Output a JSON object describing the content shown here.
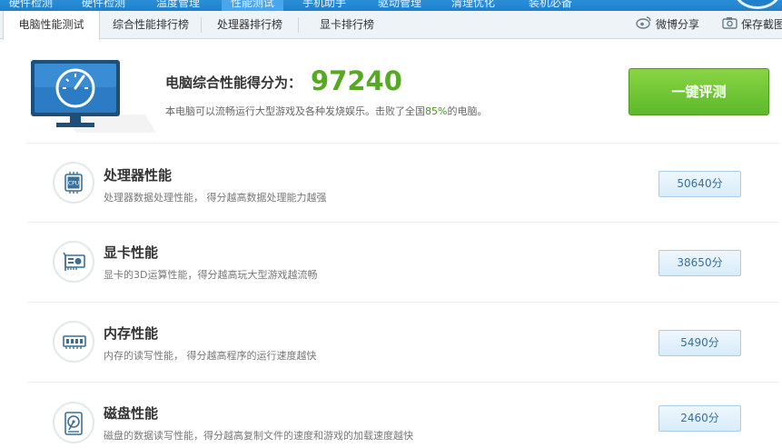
{
  "top_nav": {
    "items": [
      "硬件检测",
      "硬件检测",
      "温度管理",
      "性能测试",
      "手机助手",
      "驱动管理",
      "清理优化",
      "装机必备"
    ]
  },
  "tabs": [
    {
      "label": "电脑性能测试",
      "active": true
    },
    {
      "label": "综合性能排行榜",
      "active": false
    },
    {
      "label": "处理器排行榜",
      "active": false
    },
    {
      "label": "显卡排行榜",
      "active": false
    }
  ],
  "actions": {
    "weibo_share": "微博分享",
    "save_screenshot": "保存截图"
  },
  "summary": {
    "title": "电脑综合性能得分为：",
    "score": "97240",
    "desc_before": "本电脑可以流畅运行大型游戏及各种发烧娱乐。击败了全国",
    "beat_percent": "85%",
    "desc_after": "的电脑。",
    "button": "一键评测"
  },
  "rows": [
    {
      "icon": "cpu-icon",
      "title": "处理器性能",
      "desc": "处理器数据处理性能， 得分越高数据处理能力越强",
      "score": "50640分"
    },
    {
      "icon": "graphics-card-icon",
      "title": "显卡性能",
      "desc": "显卡的3D运算性能，得分越高玩大型游戏越流畅",
      "score": "38650分"
    },
    {
      "icon": "memory-icon",
      "title": "内存性能",
      "desc": "内存的读写性能， 得分越高程序的运行速度越快",
      "score": "5490分"
    },
    {
      "icon": "disk-icon",
      "title": "磁盘性能",
      "desc": "磁盘的数据读写性能，得分越高复制文件的速度和游戏的加载速度越快",
      "score": "2460分"
    }
  ],
  "colors": {
    "score_green": "#55aa22",
    "button_green": "#6cc432",
    "nav_blue": "#1f7fcb"
  }
}
